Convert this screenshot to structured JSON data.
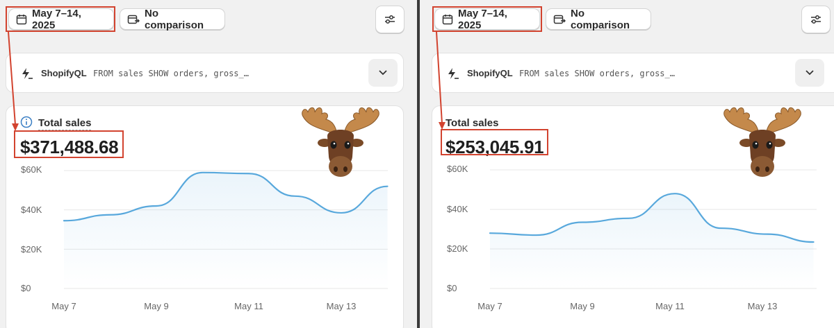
{
  "colors": {
    "accent_line": "#58a8dc",
    "annotation_red": "#d2432f",
    "gridline": "#e7e7e7",
    "text": "#2a2a2a"
  },
  "panels": [
    {
      "date_range": "May 7–14, 2025",
      "comparison": "No comparison",
      "query_label": "ShopifyQL",
      "query_text": "FROM sales SHOW orders, gross_…",
      "metric_label": "Total sales",
      "metric_value": "$371,488.68",
      "show_info_icon": true
    },
    {
      "date_range": "May 7–14, 2025",
      "comparison": "No comparison",
      "query_label": "ShopifyQL",
      "query_text": "FROM sales SHOW orders, gross_…",
      "metric_label": "Total sales",
      "metric_value": "$253,045.91",
      "show_info_icon": false
    }
  ],
  "icons": [
    "calendar-icon",
    "compare-icon",
    "settings-sliders-icon",
    "lightning-icon",
    "chevron-down-icon",
    "info-icon",
    "moose-emoji"
  ],
  "chart_data": [
    {
      "type": "area",
      "x": [
        "May 7",
        "May 8",
        "May 9",
        "May 10",
        "May 11",
        "May 12",
        "May 13",
        "May 14"
      ],
      "values": [
        34500,
        37500,
        42000,
        59000,
        58500,
        47000,
        38500,
        52000
      ],
      "ytick_labels": [
        "$0",
        "$20K",
        "$40K",
        "$60K"
      ],
      "xtick_labels": [
        "May 7",
        "May 9",
        "May 11",
        "May 13"
      ],
      "ylim": [
        0,
        60000
      ],
      "grid": true
    },
    {
      "type": "area",
      "x": [
        "May 7",
        "May 8",
        "May 9",
        "May 10",
        "May 11",
        "May 12",
        "May 13",
        "May 14"
      ],
      "values": [
        28000,
        27000,
        33500,
        35500,
        48000,
        30500,
        27500,
        23500
      ],
      "ytick_labels": [
        "$0",
        "$20K",
        "$40K",
        "$60K"
      ],
      "xtick_labels": [
        "May 7",
        "May 9",
        "May 11",
        "May 13"
      ],
      "ylim": [
        0,
        60000
      ],
      "grid": true
    }
  ]
}
